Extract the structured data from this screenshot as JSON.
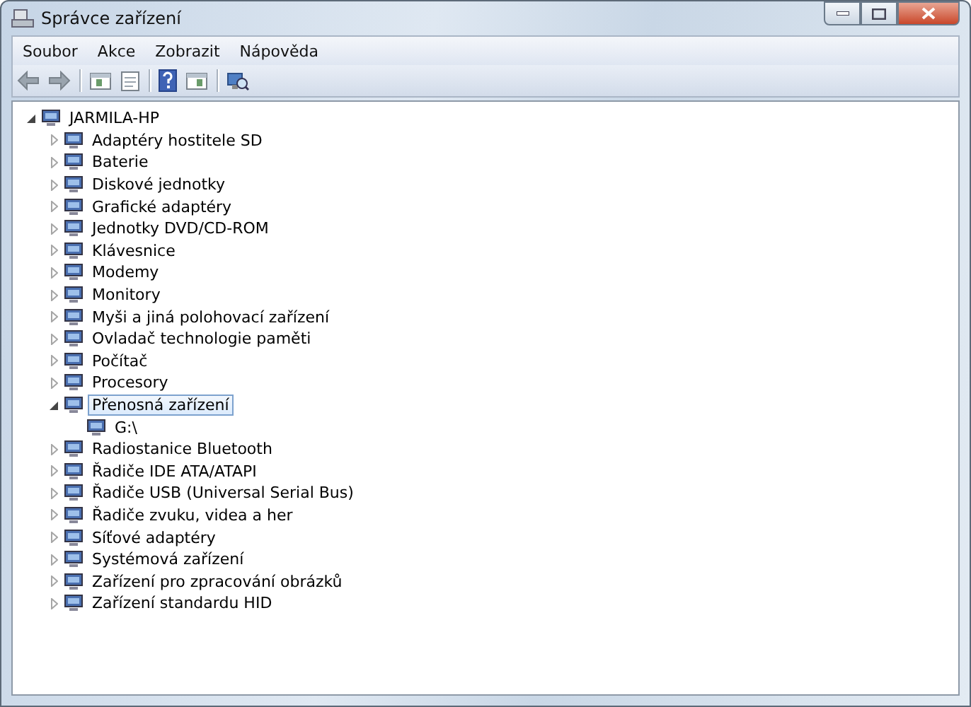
{
  "window": {
    "title": "Správce zařízení"
  },
  "menu": [
    "Soubor",
    "Akce",
    "Zobrazit",
    "Nápověda"
  ],
  "toolbar": [
    {
      "kind": "back"
    },
    {
      "kind": "forward"
    },
    {
      "kind": "sep"
    },
    {
      "kind": "pane"
    },
    {
      "kind": "sheet"
    },
    {
      "kind": "sep"
    },
    {
      "kind": "help"
    },
    {
      "kind": "console"
    },
    {
      "kind": "sep"
    },
    {
      "kind": "scan"
    }
  ],
  "tree": {
    "label": "JARMILA-HP",
    "expanded": true,
    "selected": false,
    "children": [
      {
        "label": "Adaptéry hostitele SD",
        "expanded": false,
        "selected": false
      },
      {
        "label": "Baterie",
        "expanded": false,
        "selected": false
      },
      {
        "label": "Diskové jednotky",
        "expanded": false,
        "selected": false
      },
      {
        "label": "Grafické adaptéry",
        "expanded": false,
        "selected": false
      },
      {
        "label": "Jednotky DVD/CD-ROM",
        "expanded": false,
        "selected": false
      },
      {
        "label": "Klávesnice",
        "expanded": false,
        "selected": false
      },
      {
        "label": "Modemy",
        "expanded": false,
        "selected": false
      },
      {
        "label": "Monitory",
        "expanded": false,
        "selected": false
      },
      {
        "label": "Myši a jiná polohovací zařízení",
        "expanded": false,
        "selected": false
      },
      {
        "label": "Ovladač technologie paměti",
        "expanded": false,
        "selected": false
      },
      {
        "label": "Počítač",
        "expanded": false,
        "selected": false
      },
      {
        "label": "Procesory",
        "expanded": false,
        "selected": false
      },
      {
        "label": "Přenosná zařízení",
        "expanded": true,
        "selected": true,
        "children": [
          {
            "label": "G:\\",
            "selected": false
          }
        ]
      },
      {
        "label": "Radiostanice Bluetooth",
        "expanded": false,
        "selected": false
      },
      {
        "label": "Řadiče IDE ATA/ATAPI",
        "expanded": false,
        "selected": false
      },
      {
        "label": "Řadiče USB (Universal Serial Bus)",
        "expanded": false,
        "selected": false
      },
      {
        "label": "Řadiče zvuku, videa a her",
        "expanded": false,
        "selected": false
      },
      {
        "label": "Síťové adaptéry",
        "expanded": false,
        "selected": false
      },
      {
        "label": "Systémová zařízení",
        "expanded": false,
        "selected": false
      },
      {
        "label": "Zařízení pro zpracování obrázků",
        "expanded": false,
        "selected": false
      },
      {
        "label": "Zařízení standardu HID",
        "expanded": false,
        "selected": false
      }
    ]
  }
}
